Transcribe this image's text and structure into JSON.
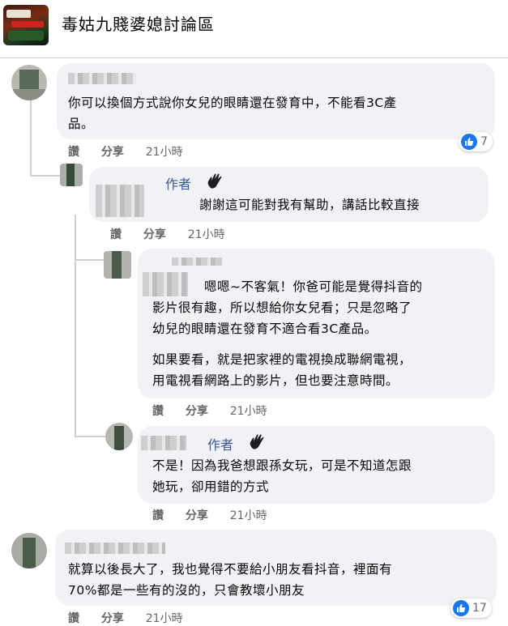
{
  "group": {
    "title": "毒姑九賤婆媳討論區"
  },
  "actions": {
    "like": "讚",
    "share": "分享"
  },
  "comments": [
    {
      "text_lines": [
        "你可以換個方式說你女兒的眼睛還在發育中，不能看3C產",
        "品。"
      ],
      "time": "21小時",
      "reactions": "7"
    },
    {
      "author_tag": "作者",
      "text_lines": [
        "謝謝這可能對我有幫助，講話比較直接"
      ],
      "time": "21小時"
    },
    {
      "text_lines": [
        "嗯嗯~不客氣！你爸可能是覺得抖音的",
        "影片很有趣，所以想給你女兒看；只是忽略了",
        "幼兒的眼睛還在發育不適合看3C產品。",
        "如果要看，就是把家裡的電視換成聯網電視，",
        "用電視看網路上的影片，但也要注意時間。"
      ],
      "time": "21小時"
    },
    {
      "author_tag": "作者",
      "text_lines": [
        "不是！因為我爸想跟孫女玩，可是不知道怎跟",
        "她玩，卻用錯的方式"
      ],
      "time": "21小時"
    },
    {
      "text_lines": [
        "就算以後長大了，我也覺得不要給小朋友看抖音，裡面有",
        "70%都是一些有的沒的，只會教壞小朋友"
      ],
      "time": "21小時",
      "reactions": "17"
    }
  ],
  "colors": {
    "bubble": "#f0f2f5",
    "author": "#385898",
    "meta": "#65676b",
    "like": "#1877f2"
  }
}
